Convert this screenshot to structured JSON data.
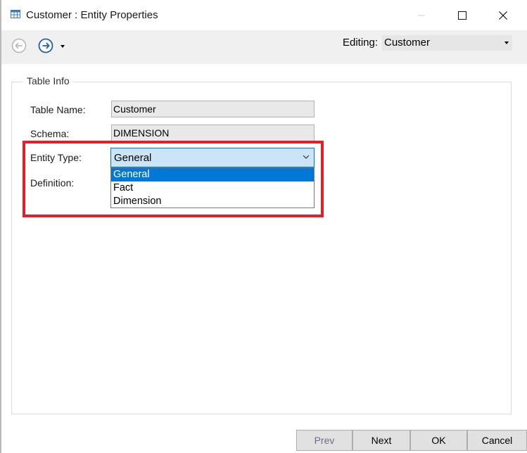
{
  "window": {
    "title": "Customer : Entity Properties",
    "icon": "table-icon"
  },
  "toolbar": {
    "back_icon": "arrow-left-circle-icon",
    "forward_icon": "arrow-right-circle-icon",
    "editing_label": "Editing:",
    "editing_value": "Customer"
  },
  "table_info": {
    "legend": "Table Info",
    "table_name_label": "Table Name:",
    "table_name_value": "Customer",
    "schema_label": "Schema:",
    "schema_value": "DIMENSION",
    "entity_type_label": "Entity Type:",
    "entity_type_value": "General",
    "definition_label": "Definition:",
    "entity_type_options": [
      "General",
      "Fact",
      "Dimension"
    ],
    "entity_type_selected": "General"
  },
  "buttons": {
    "prev": "Prev",
    "next": "Next",
    "ok": "OK",
    "cancel": "Cancel"
  },
  "colors": {
    "highlight": "#e0202b",
    "accent": "#0078d7",
    "combo_bg": "#cce4f7"
  }
}
